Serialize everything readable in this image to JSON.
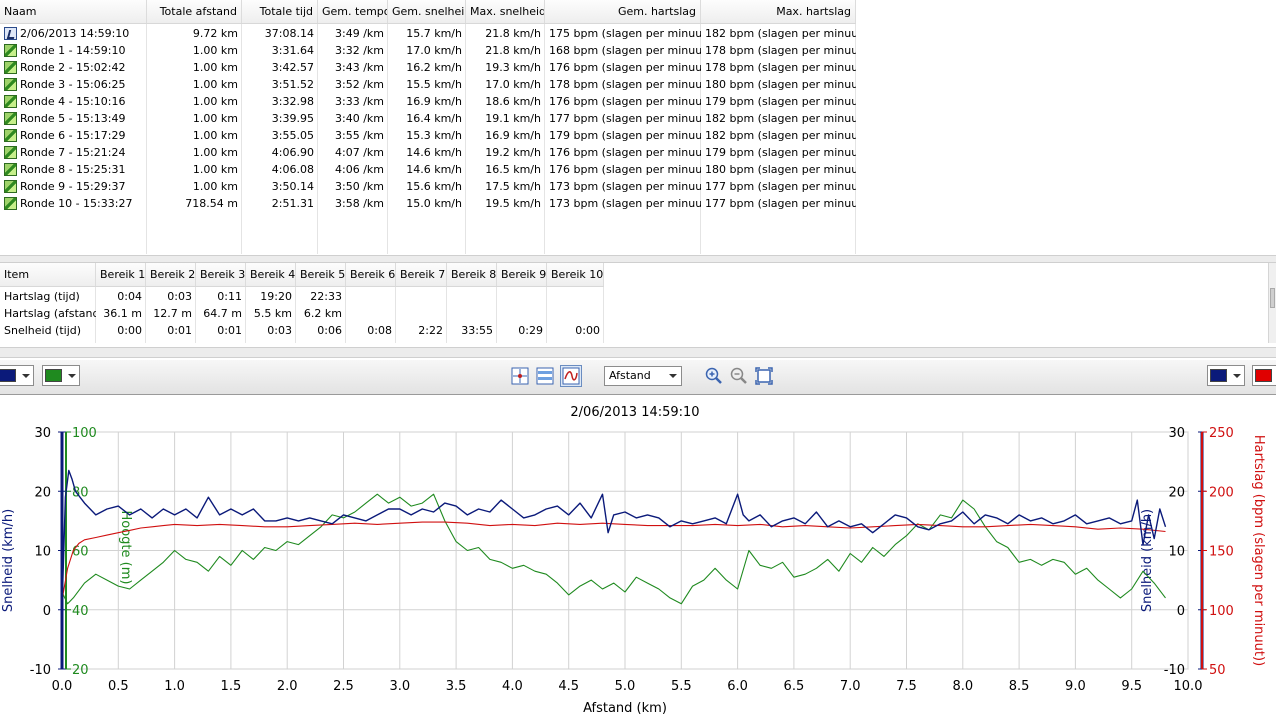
{
  "laps": {
    "columns": [
      "Naam",
      "Totale afstand",
      "Totale tijd",
      "Gem. tempo",
      "Gem. snelheid",
      "Max. snelheid",
      "Gem. hartslag",
      "Max. hartslag"
    ],
    "rows": [
      {
        "icon": "session-icon",
        "cells": [
          "2/06/2013 14:59:10",
          "9.72 km",
          "37:08.14",
          "3:49 /km",
          "15.7 km/h",
          "21.8 km/h",
          "175 bpm (slagen per minuut)",
          "182 bpm (slagen per minuut)"
        ]
      },
      {
        "icon": "lap-icon",
        "cells": [
          "Ronde 1 - 14:59:10",
          "1.00 km",
          "3:31.64",
          "3:32 /km",
          "17.0 km/h",
          "21.8 km/h",
          "168 bpm (slagen per minuut)",
          "178 bpm (slagen per minuut)"
        ]
      },
      {
        "icon": "lap-icon",
        "cells": [
          "Ronde 2 - 15:02:42",
          "1.00 km",
          "3:42.57",
          "3:43 /km",
          "16.2 km/h",
          "19.3 km/h",
          "176 bpm (slagen per minuut)",
          "178 bpm (slagen per minuut)"
        ]
      },
      {
        "icon": "lap-icon",
        "cells": [
          "Ronde 3 - 15:06:25",
          "1.00 km",
          "3:51.52",
          "3:52 /km",
          "15.5 km/h",
          "17.0 km/h",
          "178 bpm (slagen per minuut)",
          "180 bpm (slagen per minuut)"
        ]
      },
      {
        "icon": "lap-icon",
        "cells": [
          "Ronde 4 - 15:10:16",
          "1.00 km",
          "3:32.98",
          "3:33 /km",
          "16.9 km/h",
          "18.6 km/h",
          "176 bpm (slagen per minuut)",
          "179 bpm (slagen per minuut)"
        ]
      },
      {
        "icon": "lap-icon",
        "cells": [
          "Ronde 5 - 15:13:49",
          "1.00 km",
          "3:39.95",
          "3:40 /km",
          "16.4 km/h",
          "19.1 km/h",
          "177 bpm (slagen per minuut)",
          "182 bpm (slagen per minuut)"
        ]
      },
      {
        "icon": "lap-icon",
        "cells": [
          "Ronde 6 - 15:17:29",
          "1.00 km",
          "3:55.05",
          "3:55 /km",
          "15.3 km/h",
          "16.9 km/h",
          "179 bpm (slagen per minuut)",
          "182 bpm (slagen per minuut)"
        ]
      },
      {
        "icon": "lap-icon",
        "cells": [
          "Ronde 7 - 15:21:24",
          "1.00 km",
          "4:06.90",
          "4:07 /km",
          "14.6 km/h",
          "19.2 km/h",
          "176 bpm (slagen per minuut)",
          "179 bpm (slagen per minuut)"
        ]
      },
      {
        "icon": "lap-icon",
        "cells": [
          "Ronde 8 - 15:25:31",
          "1.00 km",
          "4:06.08",
          "4:06 /km",
          "14.6 km/h",
          "16.5 km/h",
          "176 bpm (slagen per minuut)",
          "180 bpm (slagen per minuut)"
        ]
      },
      {
        "icon": "lap-icon",
        "cells": [
          "Ronde 9 - 15:29:37",
          "1.00 km",
          "3:50.14",
          "3:50 /km",
          "15.6 km/h",
          "17.5 km/h",
          "173 bpm (slagen per minuut)",
          "177 bpm (slagen per minuut)"
        ]
      },
      {
        "icon": "lap-icon",
        "cells": [
          "Ronde 10 - 15:33:27",
          "718.54 m",
          "2:51.31",
          "3:58 /km",
          "15.0 km/h",
          "19.5 km/h",
          "173 bpm (slagen per minuut)",
          "177 bpm (slagen per minuut)"
        ]
      }
    ]
  },
  "zones": {
    "columns": [
      "Item",
      "Bereik 1",
      "Bereik 2",
      "Bereik 3",
      "Bereik 4",
      "Bereik 5",
      "Bereik 6",
      "Bereik 7",
      "Bereik 8",
      "Bereik 9",
      "Bereik 10"
    ],
    "rows": [
      [
        "Hartslag (tijd)",
        "0:04",
        "0:03",
        "0:11",
        "19:20",
        "22:33",
        "",
        "",
        "",
        "",
        ""
      ],
      [
        "Hartslag (afstand)",
        "36.1 m",
        "12.7 m",
        "64.7 m",
        "5.5 km",
        "6.2 km",
        "",
        "",
        "",
        "",
        ""
      ],
      [
        "Snelheid (tijd)",
        "0:00",
        "0:01",
        "0:01",
        "0:03",
        "0:06",
        "0:08",
        "2:22",
        "33:55",
        "0:29",
        "0:00"
      ]
    ]
  },
  "toolbar": {
    "left_colors": [
      "#0b1a7a",
      "#1f8a1f"
    ],
    "right_colors": [
      "#0b1a7a",
      "#e00000"
    ],
    "x_axis_select": "Afstand",
    "buttons": [
      "crosshair-icon",
      "bands-icon",
      "smooth-icon",
      "zoom-in-icon",
      "zoom-out-icon",
      "fit-icon"
    ]
  },
  "chart_data": {
    "type": "line",
    "title": "2/06/2013 14:59:10",
    "xlabel": "Afstand (km)",
    "xlim": [
      0,
      10
    ],
    "xticks": [
      "0.0",
      "0.5",
      "1.0",
      "1.5",
      "2.0",
      "2.5",
      "3.0",
      "3.5",
      "4.0",
      "4.5",
      "5.0",
      "5.5",
      "6.0",
      "6.5",
      "7.0",
      "7.5",
      "8.0",
      "8.5",
      "9.0",
      "9.5",
      "10.0"
    ],
    "axes": {
      "speed": {
        "label": "Snelheid (km/h)",
        "range": [
          -10,
          30
        ],
        "ticks": [
          "-10",
          "0",
          "10",
          "20",
          "30"
        ],
        "color": "#0b1a7a"
      },
      "elevation": {
        "label": "Hoogte (m)",
        "range": [
          20,
          100
        ],
        "ticks": [
          "20",
          "40",
          "60",
          "80",
          "100"
        ],
        "color": "#1f8a1f"
      },
      "heartrate": {
        "label": "Hartslag (bpm (slagen per minuut))",
        "range": [
          50,
          250
        ],
        "ticks": [
          "50",
          "100",
          "150",
          "200",
          "250"
        ],
        "color": "#d01010"
      }
    },
    "series": [
      {
        "name": "Snelheid (km/h)",
        "axis": "speed",
        "color": "#0b1a7a",
        "x": [
          0,
          0.03,
          0.06,
          0.09,
          0.12,
          0.2,
          0.3,
          0.4,
          0.5,
          0.6,
          0.7,
          0.8,
          0.9,
          1.0,
          1.1,
          1.2,
          1.3,
          1.4,
          1.5,
          1.6,
          1.7,
          1.8,
          1.9,
          2.0,
          2.1,
          2.2,
          2.3,
          2.4,
          2.5,
          2.6,
          2.7,
          2.8,
          2.9,
          3.0,
          3.1,
          3.2,
          3.3,
          3.4,
          3.5,
          3.6,
          3.7,
          3.8,
          3.9,
          4.0,
          4.1,
          4.2,
          4.3,
          4.4,
          4.5,
          4.6,
          4.7,
          4.8,
          4.85,
          4.9,
          5.0,
          5.1,
          5.2,
          5.3,
          5.4,
          5.5,
          5.6,
          5.7,
          5.8,
          5.9,
          6.0,
          6.05,
          6.1,
          6.2,
          6.3,
          6.4,
          6.5,
          6.6,
          6.7,
          6.8,
          6.9,
          7.0,
          7.1,
          7.2,
          7.3,
          7.4,
          7.5,
          7.6,
          7.7,
          7.8,
          7.9,
          8.0,
          8.1,
          8.2,
          8.3,
          8.4,
          8.5,
          8.6,
          8.7,
          8.8,
          8.9,
          9.0,
          9.1,
          9.2,
          9.3,
          9.4,
          9.5,
          9.55,
          9.6,
          9.65,
          9.7,
          9.75,
          9.8
        ],
        "y": [
          0,
          19,
          23.5,
          22,
          20,
          18,
          16,
          17,
          17.5,
          16,
          17,
          15.5,
          17,
          16,
          17,
          15.5,
          19,
          16,
          17,
          16,
          17,
          15,
          15,
          15.5,
          15,
          15.5,
          15,
          14.5,
          16,
          15.5,
          15,
          16,
          17,
          17,
          16,
          17,
          16.5,
          18,
          17.5,
          16,
          17,
          16.5,
          18.5,
          17,
          15.5,
          16,
          17,
          17.5,
          16,
          18,
          15.5,
          19.5,
          13,
          16,
          16.5,
          15.5,
          16,
          15.5,
          14,
          15,
          14.5,
          15,
          15.5,
          14.5,
          19.5,
          16,
          15,
          16,
          14,
          15,
          15.5,
          14.5,
          16.5,
          14,
          15,
          14,
          14.5,
          13,
          14.5,
          16,
          15.5,
          14,
          13.5,
          14.5,
          15,
          16.5,
          14.5,
          16,
          15.5,
          14.5,
          16,
          15,
          15.5,
          14.5,
          15,
          16,
          14.5,
          15,
          15.5,
          14.5,
          15,
          18.5,
          11,
          16,
          12,
          17,
          14
        ]
      },
      {
        "name": "Hoogte (m)",
        "axis": "elevation",
        "color": "#1f8a1f",
        "x": [
          0,
          0.05,
          0.1,
          0.2,
          0.3,
          0.4,
          0.5,
          0.6,
          0.7,
          0.8,
          0.9,
          1.0,
          1.1,
          1.2,
          1.3,
          1.4,
          1.5,
          1.6,
          1.7,
          1.8,
          1.9,
          2.0,
          2.1,
          2.2,
          2.3,
          2.4,
          2.5,
          2.6,
          2.7,
          2.8,
          2.9,
          3.0,
          3.1,
          3.2,
          3.3,
          3.4,
          3.5,
          3.6,
          3.7,
          3.8,
          3.9,
          4.0,
          4.1,
          4.2,
          4.3,
          4.4,
          4.5,
          4.6,
          4.7,
          4.8,
          4.9,
          5.0,
          5.1,
          5.2,
          5.3,
          5.4,
          5.5,
          5.6,
          5.7,
          5.8,
          5.9,
          6.0,
          6.1,
          6.2,
          6.3,
          6.4,
          6.5,
          6.6,
          6.7,
          6.8,
          6.9,
          7.0,
          7.1,
          7.2,
          7.3,
          7.4,
          7.5,
          7.6,
          7.7,
          7.8,
          7.9,
          8.0,
          8.1,
          8.2,
          8.3,
          8.4,
          8.5,
          8.6,
          8.7,
          8.8,
          8.9,
          9.0,
          9.1,
          9.2,
          9.3,
          9.4,
          9.5,
          9.6,
          9.7,
          9.8
        ],
        "y": [
          46,
          42,
          44,
          49,
          52,
          50,
          48,
          47,
          50,
          53,
          56,
          60,
          57,
          56,
          53,
          58,
          55,
          60,
          57,
          61,
          60,
          63,
          62,
          65,
          68,
          72,
          71,
          73,
          76,
          79,
          76,
          78,
          75,
          76,
          79,
          70,
          63,
          60,
          61,
          57,
          56,
          54,
          55,
          53,
          52,
          49,
          45,
          48,
          50,
          47,
          49,
          46,
          51,
          49,
          47,
          44,
          42,
          48,
          50,
          54,
          50,
          47,
          60,
          55,
          54,
          56,
          51,
          52,
          54,
          57,
          53,
          59,
          56,
          61,
          58,
          62,
          65,
          69,
          67,
          72,
          71,
          77,
          74,
          68,
          63,
          61,
          56,
          57,
          55,
          57,
          56,
          52,
          54,
          50,
          47,
          44,
          47,
          53,
          49,
          44
        ]
      },
      {
        "name": "Hartslag (bpm (slagen per minuut))",
        "axis": "heartrate",
        "color": "#d01010",
        "x": [
          0,
          0.05,
          0.1,
          0.15,
          0.2,
          0.3,
          0.4,
          0.5,
          0.6,
          0.7,
          0.8,
          0.9,
          1.0,
          1.2,
          1.4,
          1.6,
          1.8,
          2.0,
          2.2,
          2.4,
          2.6,
          2.8,
          3.0,
          3.2,
          3.4,
          3.6,
          3.8,
          4.0,
          4.2,
          4.4,
          4.6,
          4.8,
          5.0,
          5.2,
          5.4,
          5.6,
          5.8,
          6.0,
          6.2,
          6.4,
          6.6,
          6.8,
          7.0,
          7.2,
          7.4,
          7.6,
          7.8,
          8.0,
          8.2,
          8.4,
          8.6,
          8.8,
          9.0,
          9.2,
          9.4,
          9.6,
          9.8
        ],
        "y": [
          108,
          135,
          150,
          156,
          159,
          161,
          163,
          165,
          167,
          169,
          170,
          171,
          172,
          171,
          172,
          171,
          170,
          170,
          171,
          172,
          173,
          172,
          173,
          174,
          174,
          173,
          171,
          172,
          171,
          173,
          172,
          173,
          172,
          171,
          171,
          171,
          172,
          171,
          172,
          170,
          171,
          170,
          169,
          170,
          171,
          172,
          171,
          170,
          170,
          171,
          172,
          171,
          170,
          168,
          169,
          168,
          166
        ]
      }
    ]
  }
}
